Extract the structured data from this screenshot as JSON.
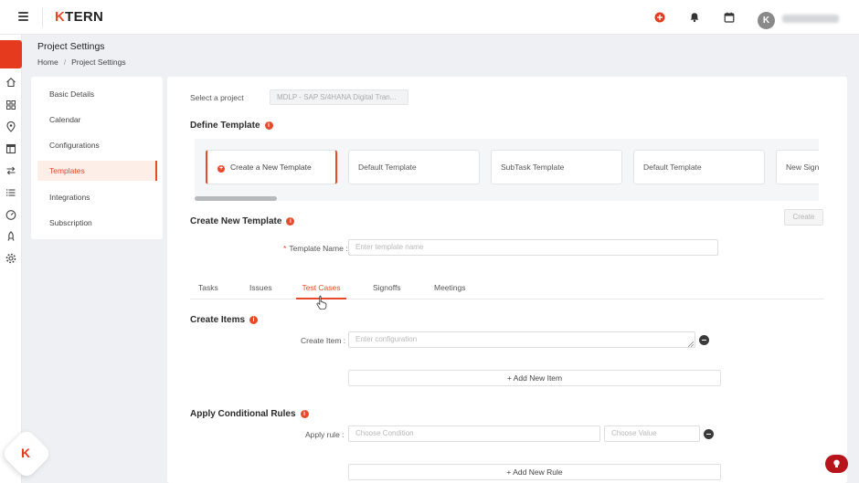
{
  "app": {
    "logo_text_k": "K",
    "logo_text_rest": "TERN",
    "accent": "#e8492b"
  },
  "header_icons": [
    "add-circle-icon",
    "bell-icon",
    "calendar-icon"
  ],
  "user": {
    "avatar_initial": "K"
  },
  "rail_icons": [
    "home-icon",
    "grid-icon",
    "location-icon",
    "board-icon",
    "transfer-icon",
    "list-icon",
    "dashboard-icon",
    "rocket-icon",
    "settings-icon"
  ],
  "page": {
    "title": "Project Settings",
    "breadcrumb": {
      "home": "Home",
      "separator": "/",
      "current": "Project Settings"
    }
  },
  "sidenav": {
    "items": [
      {
        "label": "Basic Details",
        "active": false
      },
      {
        "label": "Calendar",
        "active": false
      },
      {
        "label": "Configurations",
        "active": false
      },
      {
        "label": "Templates",
        "active": true
      },
      {
        "label": "Integrations",
        "active": false
      },
      {
        "label": "Subscription",
        "active": false
      }
    ]
  },
  "main": {
    "select_project_label": "Select a project",
    "select_project_value": "MDLP - SAP S/4HANA Digital Tran...",
    "define_template_title": "Define Template",
    "info_glyph": "i",
    "templates": [
      {
        "label": "Create a New Template",
        "is_new": true
      },
      {
        "label": "Default Template",
        "is_new": false
      },
      {
        "label": "SubTask Template",
        "is_new": false
      },
      {
        "label": "Default Template",
        "is_new": false
      },
      {
        "label": "New Signoff Template",
        "is_new": false
      }
    ],
    "create_new_title": "Create New Template",
    "create_button": "Create",
    "required_mark": "*",
    "template_name_label": "Template Name :",
    "template_name_placeholder": "Enter template name",
    "tabs": [
      {
        "label": "Tasks",
        "active": false
      },
      {
        "label": "Issues",
        "active": false
      },
      {
        "label": "Test Cases",
        "active": true
      },
      {
        "label": "Signoffs",
        "active": false
      },
      {
        "label": "Meetings",
        "active": false
      }
    ],
    "create_items_title": "Create Items",
    "create_item_label": "Create Item :",
    "create_item_placeholder": "Enter configuration",
    "add_item_button": "+ Add New Item",
    "conditional_title": "Apply Conditional Rules",
    "apply_rule_label": "Apply rule :",
    "condition_placeholder": "Choose Condition",
    "value_placeholder": "Choose Value",
    "add_rule_button": "+ Add New Rule"
  }
}
